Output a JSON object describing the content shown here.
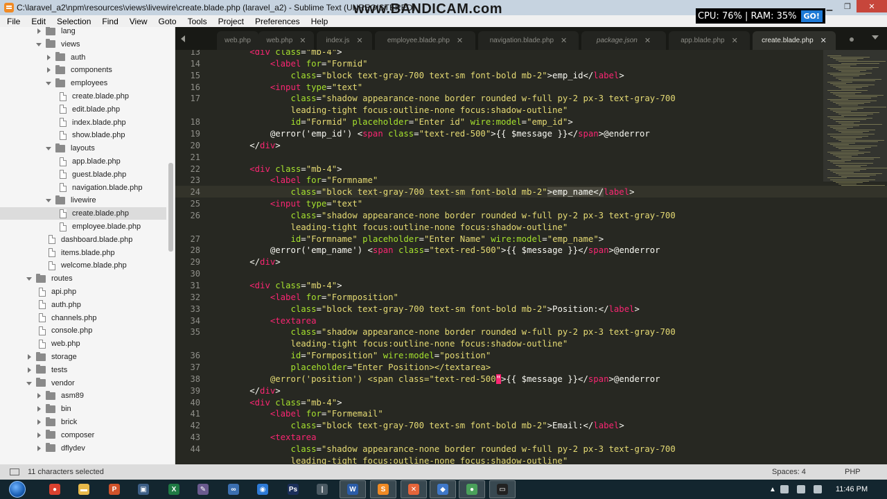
{
  "window": {
    "title": "C:\\laravel_a2\\npm\\resources\\views\\livewire\\create.blade.php (laravel_a2) - Sublime Text (UNREGISTERED)",
    "watermark": "www.BANDICAM.com"
  },
  "perf": {
    "cpu": "CPU:  76%",
    "ram": "RAM:  35%",
    "go": "GO!"
  },
  "menu": [
    "File",
    "Edit",
    "Selection",
    "Find",
    "View",
    "Goto",
    "Tools",
    "Project",
    "Preferences",
    "Help"
  ],
  "sidebar": [
    {
      "label": "lang",
      "kind": "folder",
      "depth": 2,
      "arrow": "right"
    },
    {
      "label": "views",
      "kind": "folder",
      "depth": 2,
      "arrow": "down"
    },
    {
      "label": "auth",
      "kind": "folder",
      "depth": 3,
      "arrow": "right"
    },
    {
      "label": "components",
      "kind": "folder",
      "depth": 3,
      "arrow": "right"
    },
    {
      "label": "employees",
      "kind": "folder",
      "depth": 3,
      "arrow": "down"
    },
    {
      "label": "create.blade.php",
      "kind": "file",
      "depth": 4
    },
    {
      "label": "edit.blade.php",
      "kind": "file",
      "depth": 4
    },
    {
      "label": "index.blade.php",
      "kind": "file",
      "depth": 4
    },
    {
      "label": "show.blade.php",
      "kind": "file",
      "depth": 4
    },
    {
      "label": "layouts",
      "kind": "folder",
      "depth": 3,
      "arrow": "down"
    },
    {
      "label": "app.blade.php",
      "kind": "file",
      "depth": 4
    },
    {
      "label": "guest.blade.php",
      "kind": "file",
      "depth": 4
    },
    {
      "label": "navigation.blade.php",
      "kind": "file",
      "depth": 4
    },
    {
      "label": "livewire",
      "kind": "folder",
      "depth": 3,
      "arrow": "down"
    },
    {
      "label": "create.blade.php",
      "kind": "file",
      "depth": 4,
      "selected": true
    },
    {
      "label": "employee.blade.php",
      "kind": "file",
      "depth": 4
    },
    {
      "label": "dashboard.blade.php",
      "kind": "file",
      "depth": 3
    },
    {
      "label": "items.blade.php",
      "kind": "file",
      "depth": 3
    },
    {
      "label": "welcome.blade.php",
      "kind": "file",
      "depth": 3
    },
    {
      "label": "routes",
      "kind": "folder",
      "depth": 1,
      "arrow": "down"
    },
    {
      "label": "api.php",
      "kind": "file",
      "depth": 2
    },
    {
      "label": "auth.php",
      "kind": "file",
      "depth": 2
    },
    {
      "label": "channels.php",
      "kind": "file",
      "depth": 2
    },
    {
      "label": "console.php",
      "kind": "file",
      "depth": 2
    },
    {
      "label": "web.php",
      "kind": "file",
      "depth": 2
    },
    {
      "label": "storage",
      "kind": "folder",
      "depth": 1,
      "arrow": "right"
    },
    {
      "label": "tests",
      "kind": "folder",
      "depth": 1,
      "arrow": "right"
    },
    {
      "label": "vendor",
      "kind": "folder",
      "depth": 1,
      "arrow": "down"
    },
    {
      "label": "asm89",
      "kind": "folder",
      "depth": 2,
      "arrow": "right"
    },
    {
      "label": "bin",
      "kind": "folder",
      "depth": 2,
      "arrow": "right"
    },
    {
      "label": "brick",
      "kind": "folder",
      "depth": 2,
      "arrow": "right"
    },
    {
      "label": "composer",
      "kind": "folder",
      "depth": 2,
      "arrow": "right"
    },
    {
      "label": "dflydev",
      "kind": "folder",
      "depth": 2,
      "arrow": "right"
    }
  ],
  "tabs": [
    {
      "label": "web.php",
      "close": false
    },
    {
      "label": "web.php",
      "close": true
    },
    {
      "label": "index.js",
      "close": true
    },
    {
      "label": "employee.blade.php",
      "close": true
    },
    {
      "label": "navigation.blade.php",
      "close": true
    },
    {
      "label": "package.json",
      "close": true,
      "italic": true
    },
    {
      "label": "app.blade.php",
      "close": true
    },
    {
      "label": "create.blade.php",
      "close": true,
      "active": true
    }
  ],
  "editor": {
    "first_line": 13,
    "lines": [
      "        <t>&lt;div</t> <a>class</a>=<s>\"mb-4\"</s>>",
      "            <t>&lt;label</t> <a>for</a>=<s>\"Formid\"</s>",
      "                <a>class</a>=<s>\"block text-gray-700 text-sm font-bold mb-2\"</s>>emp_id&lt;/<t>label</t>>",
      "            <t>&lt;input</t> <a>type</a>=<s>\"text\"</s>",
      "                <a>class</a>=<s>\"shadow appearance-none border rounded w-full py-2 px-3 text-gray-700</s>",
      "<s>                leading-tight focus:outline-none focus:shadow-outline\"</s>",
      "                <a>id</a>=<s>\"Formid\"</s> <a>placeholder</a>=<s>\"Enter id\"</s> <a>wire:model</a>=<s>\"emp_id\"</s>>",
      "            @error('emp_id') &lt;<t>span</t> <a>class</a>=<s>\"text-red-500\"</s>>{{ $message }}&lt;/<t>span</t>>@enderror",
      "        &lt;/<t>div</t>>",
      "",
      "        <t>&lt;div</t> <a>class</a>=<s>\"mb-4\"</s>>",
      "            <t>&lt;label</t> <a>for</a>=<s>\"Formname\"</s>",
      "                <a>class</a>=<s>\"block text-gray-700 text-sm font-bold mb-2\"</s><h>>emp_name&lt;/</h><t>label</t>>",
      "            <t>&lt;input</t> <a>type</a>=<s>\"text\"</s>",
      "                <a>class</a>=<s>\"shadow appearance-none border rounded w-full py-2 px-3 text-gray-700</s>",
      "<s>                leading-tight focus:outline-none focus:shadow-outline\"</s>",
      "                <a>id</a>=<s>\"Formname\"</s> <a>placeholder</a>=<s>\"Enter Name\"</s> <a>wire:model</a>=<s>\"emp_name\"</s>>",
      "            @error('emp_name') &lt;<t>span</t> <a>class</a>=<s>\"text-red-500\"</s>>{{ $message }}&lt;/<t>span</t>>@enderror",
      "        &lt;/<t>div</t>>",
      "",
      "        <t>&lt;div</t> <a>class</a>=<s>\"mb-4\"</s>>",
      "            <t>&lt;label</t> <a>for</a>=<s>\"Formposition\"</s>",
      "                <a>class</a>=<s>\"block text-gray-700 text-sm font-bold mb-2\"</s>>Position:&lt;/<t>label</t>>",
      "            <t>&lt;textarea</t>",
      "                <a>class</a>=<s>\"shadow appearance-none border rounded w-full py-2 px-3 text-gray-700</s>",
      "<s>                leading-tight focus:outline-none focus:shadow-outline\"</s>",
      "                <a>id</a>=<s>\"Formposition\"</s> <a>wire:model</a>=<s>\"position\"</s>",
      "                <a>placeholder</a>=<s>\"Enter Position>&lt;/textarea></s>",
      "            <s>@error('position') &lt;span class=\"text-red-500</s><e>\"</e>>{{ $message }}&lt;/<t>span</t>>@enderror",
      "        &lt;/<t>div</t>>",
      "        <t>&lt;div</t> <a>class</a>=<s>\"mb-4\"</s>>",
      "            <t>&lt;label</t> <a>for</a>=<s>\"Formemail\"</s>",
      "                <a>class</a>=<s>\"block text-gray-700 text-sm font-bold mb-2\"</s>>Email:&lt;/<t>label</t>>",
      "            <t>&lt;textarea</t>",
      "                <a>class</a>=<s>\"shadow appearance-none border rounded w-full py-2 px-3 text-gray-700</s>",
      "<s>                leading-tight focus:outline-none focus:shadow-outline\"</s>"
    ],
    "line_numbers": [
      "13",
      "14",
      "15",
      "16",
      "17",
      "",
      "18",
      "19",
      "20",
      "21",
      "22",
      "23",
      "24",
      "25",
      "26",
      "",
      "27",
      "28",
      "29",
      "30",
      "31",
      "32",
      "33",
      "34",
      "35",
      "",
      "36",
      "37",
      "38",
      "39",
      "40",
      "41",
      "42",
      "43",
      "44",
      ""
    ]
  },
  "status": {
    "selection": "11 characters selected",
    "spaces": "Spaces: 4",
    "syntax": "PHP"
  },
  "taskbar": {
    "clock": "11:46 PM",
    "apps": [
      {
        "name": "chrome-icon",
        "color": "#d9412f",
        "glyph": "●"
      },
      {
        "name": "explorer-icon",
        "color": "#e7b94a",
        "glyph": "▬"
      },
      {
        "name": "powerpoint-icon",
        "color": "#d0532b",
        "glyph": "P"
      },
      {
        "name": "monitor-icon",
        "color": "#3d5f86",
        "glyph": "▣"
      },
      {
        "name": "excel-icon",
        "color": "#1f7a44",
        "glyph": "X"
      },
      {
        "name": "tool-icon",
        "color": "#6a5a8e",
        "glyph": "✎"
      },
      {
        "name": "link-icon",
        "color": "#3b6fb0",
        "glyph": "∞"
      },
      {
        "name": "globe-icon",
        "color": "#2d7ad6",
        "glyph": "◉"
      },
      {
        "name": "photoshop-icon",
        "color": "#1b2f5a",
        "glyph": "Ps"
      },
      {
        "name": "cursor-app-icon",
        "color": "#4b5a63",
        "glyph": "|"
      },
      {
        "name": "word-icon",
        "color": "#2b5ca8",
        "glyph": "W"
      },
      {
        "name": "sublime-icon",
        "color": "#f08a24",
        "glyph": "S"
      },
      {
        "name": "xampp-icon",
        "color": "#e5653a",
        "glyph": "✕"
      },
      {
        "name": "box-icon",
        "color": "#3f78c9",
        "glyph": "◆"
      },
      {
        "name": "chrome-alt-icon",
        "color": "#4aa05a",
        "glyph": "●"
      },
      {
        "name": "terminal-icon",
        "color": "#222",
        "glyph": "▭"
      }
    ]
  }
}
